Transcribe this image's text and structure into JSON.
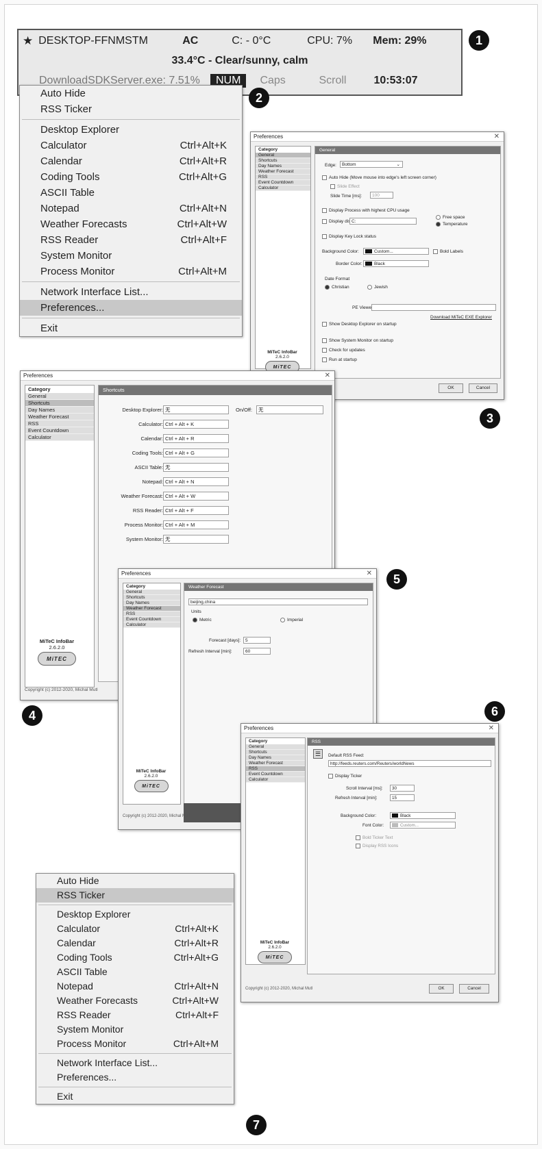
{
  "badges": [
    "1",
    "2",
    "3",
    "4",
    "5",
    "6",
    "7"
  ],
  "infobar": {
    "star_icon": "star-icon",
    "computer_name": "DESKTOP-FFNMSTM",
    "power": "AC",
    "drive": "C: - 0°C",
    "cpu": "CPU: 7%",
    "mem": "Mem: 29%",
    "weather": "33.4°C - Clear/sunny, calm",
    "process": "DownloadSDKServer.exe: 7.51%",
    "num": "NUM",
    "caps": "Caps",
    "scroll": "Scroll",
    "time": "10:53:07"
  },
  "menu": {
    "items": [
      {
        "label": "Auto Hide",
        "shortcut": ""
      },
      {
        "label": "RSS Ticker",
        "shortcut": ""
      },
      {
        "label": "Desktop Explorer",
        "shortcut": ""
      },
      {
        "label": "Calculator",
        "shortcut": "Ctrl+Alt+K"
      },
      {
        "label": "Calendar",
        "shortcut": "Ctrl+Alt+R"
      },
      {
        "label": "Coding Tools",
        "shortcut": "Ctrl+Alt+G"
      },
      {
        "label": "ASCII Table",
        "shortcut": ""
      },
      {
        "label": "Notepad",
        "shortcut": "Ctrl+Alt+N"
      },
      {
        "label": "Weather Forecasts",
        "shortcut": "Ctrl+Alt+W"
      },
      {
        "label": "RSS Reader",
        "shortcut": "Ctrl+Alt+F"
      },
      {
        "label": "System Monitor",
        "shortcut": ""
      },
      {
        "label": "Process Monitor",
        "shortcut": "Ctrl+Alt+M"
      },
      {
        "label": "Network Interface List...",
        "shortcut": ""
      },
      {
        "label": "Preferences...",
        "shortcut": ""
      },
      {
        "label": "Exit",
        "shortcut": ""
      }
    ]
  },
  "prefs": {
    "title": "Preferences",
    "category_header": "Category",
    "categories": [
      "General",
      "Shortcuts",
      "Day Names",
      "Weather Forecast",
      "RSS",
      "Event Countdown",
      "Calculator"
    ],
    "logo_name": "MiTeC InfoBar",
    "version": "2.6.2.0",
    "logo_text": "MiTEC",
    "copyright": "Copyright (c) 2012-2020, Michal Mutl",
    "ok": "OK",
    "cancel": "Cancel"
  },
  "general": {
    "header": "General",
    "edge_label": "Edge:",
    "edge_value": "Bottom",
    "auto_hide": "Auto Hide (Move mouse into edge's left screen corner)",
    "slide_effect": "Slide Effect",
    "slide_time_label": "Slide Time [ms]:",
    "slide_time_value": "100",
    "display_process": "Display Process with highest CPU usage",
    "display_disk": "Display disk",
    "disk_value": "C:",
    "free_space": "Free space",
    "temperature": "Temperature",
    "key_lock": "Display Key Lock status",
    "bg_color_label": "Background Color:",
    "bg_color_value": "Custom...",
    "bold_labels": "Bold Labels",
    "border_color_label": "Border Color:",
    "border_color_value": "Black",
    "date_format": "Date Format",
    "christian": "Christian",
    "jewish": "Jewish",
    "pe_viewer": "PE Viewer:",
    "download_link": "Download MiTeC EXE Explorer",
    "show_desktop_explorer": "Show Desktop Explorer on startup",
    "show_system_monitor": "Show System Monitor on startup",
    "check_updates": "Check for updates",
    "run_startup": "Run at startup"
  },
  "shortcuts": {
    "header": "Shortcuts",
    "onoff_label": "On/Off:",
    "onoff_value": "无",
    "rows": [
      {
        "label": "Desktop Explorer:",
        "value": "无"
      },
      {
        "label": "Calculator:",
        "value": "Ctrl + Alt + K"
      },
      {
        "label": "Calendar:",
        "value": "Ctrl + Alt + R"
      },
      {
        "label": "Coding Tools:",
        "value": "Ctrl + Alt + G"
      },
      {
        "label": "ASCII Table:",
        "value": "无"
      },
      {
        "label": "Notepad:",
        "value": "Ctrl + Alt + N"
      },
      {
        "label": "Weather Forecast:",
        "value": "Ctrl + Alt + W"
      },
      {
        "label": "RSS Reader:",
        "value": "Ctrl + Alt + F"
      },
      {
        "label": "Process Monitor:",
        "value": "Ctrl + Alt + M"
      },
      {
        "label": "System Monitor:",
        "value": "无"
      }
    ]
  },
  "weather": {
    "header": "Weather Forecast",
    "location": "beijing,china",
    "units_label": "Units",
    "metric": "Metric",
    "imperial": "Imperial",
    "forecast_label": "Forecast [days]:",
    "forecast_value": "5",
    "refresh_label": "Refresh Interval [min]:",
    "refresh_value": "60"
  },
  "rss": {
    "header": "RSS",
    "rss_icon": "rss-icon",
    "default_feed_label": "Default RSS Feed:",
    "feed_url": "http://feeds.reuters.com/Reuters/worldNews",
    "display_ticker": "Display Ticker",
    "scroll_label": "Scroll Interval [ms]:",
    "scroll_value": "30",
    "refresh_label": "Refresh Interval [min]:",
    "refresh_value": "15",
    "bg_label": "Background Color:",
    "bg_value": "Black",
    "font_label": "Font Color:",
    "font_value": "Custom...",
    "bold_ticker": "Bold Ticker Text",
    "display_icons": "Display RSS Icons"
  }
}
